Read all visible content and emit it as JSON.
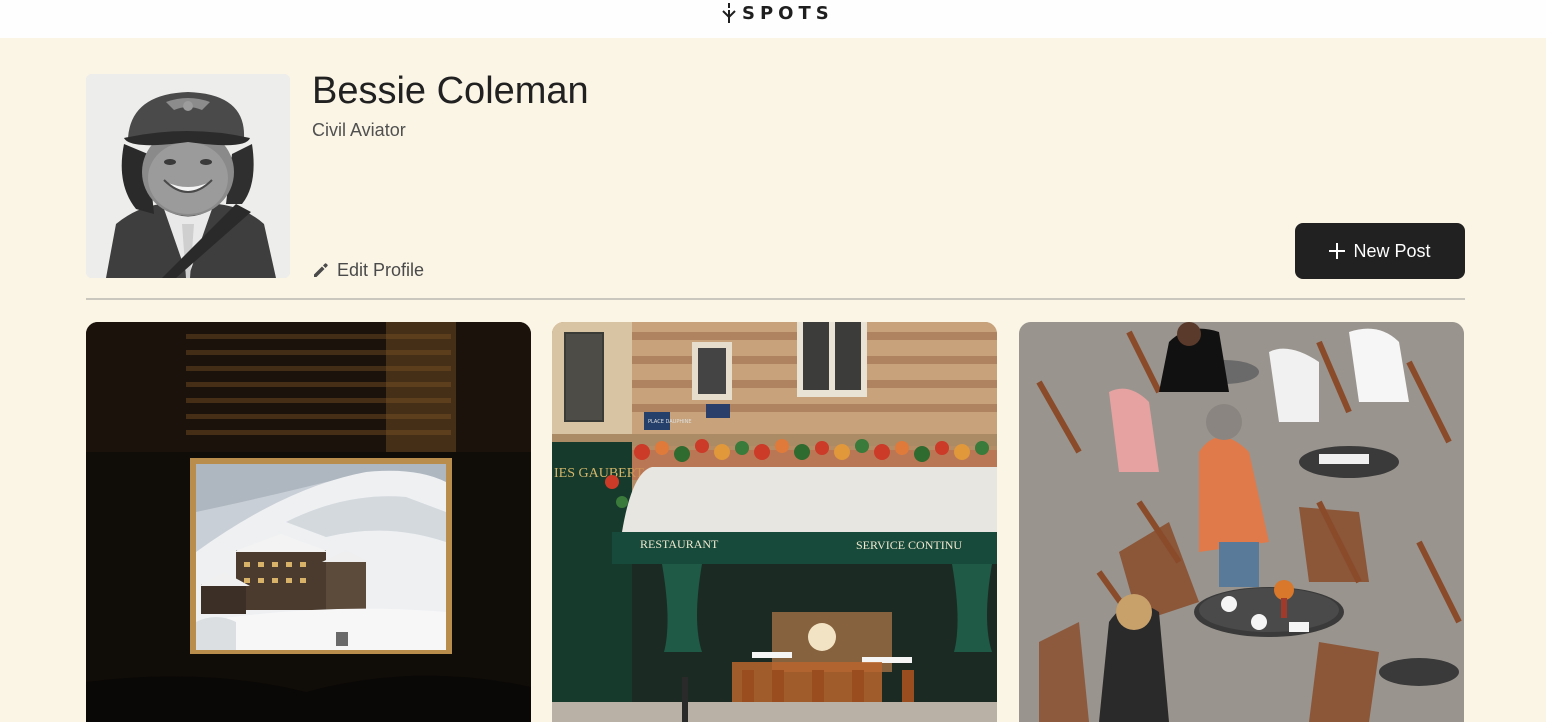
{
  "app": {
    "logo_text": "SPOTS"
  },
  "profile": {
    "name": "Bessie Coleman",
    "title": "Civil Aviator",
    "edit_label": "Edit Profile"
  },
  "actions": {
    "new_post_label": "New Post"
  },
  "cards": [
    {
      "image": "snowy-village-through-window"
    },
    {
      "image": "paris-restaurant-facade",
      "sign_left": "IES GAUBERT",
      "awning_left": "RESTAURANT",
      "awning_right": "SERVICE CONTINU",
      "plaque": "PLACE DAUPHINE"
    },
    {
      "image": "outdoor-cafe-tables"
    }
  ],
  "colors": {
    "page_bg": "#fbf5e6",
    "header_bg": "#fefefe",
    "button_bg": "#212121",
    "text": "#212121",
    "muted": "#505050"
  },
  "icons": {
    "logo": "spots-logo-icon",
    "edit": "pencil-icon",
    "new_post": "plus-icon"
  }
}
